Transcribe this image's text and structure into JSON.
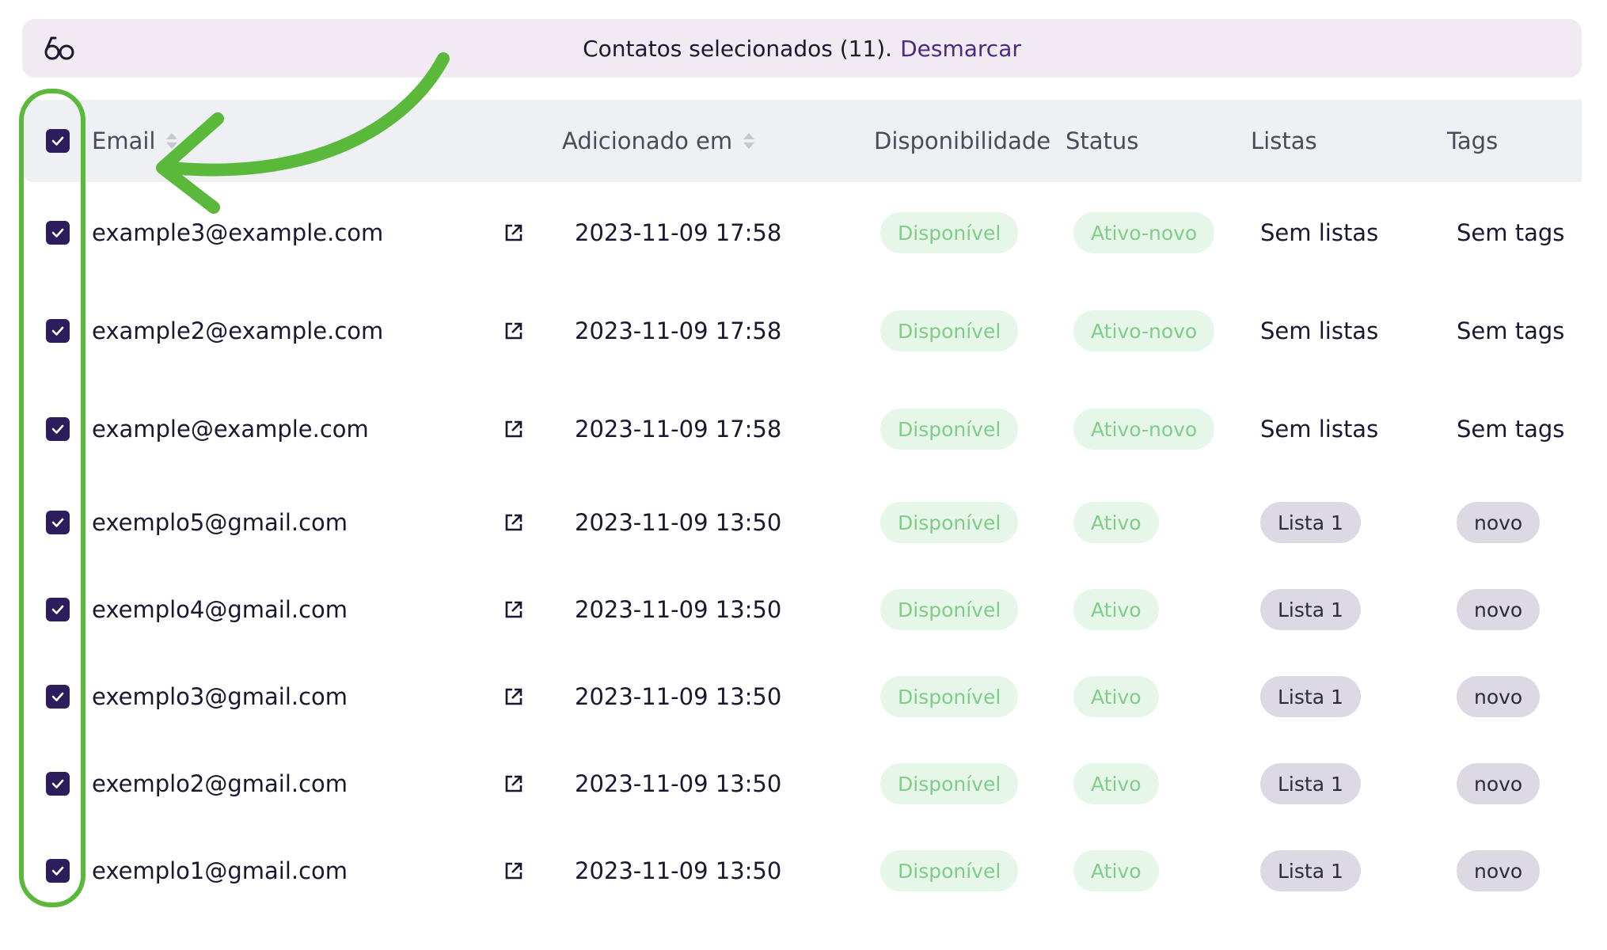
{
  "banner": {
    "message": "Contatos selecionados (11).",
    "unselect_link": "Desmarcar",
    "icon": "glasses-icon"
  },
  "table": {
    "headers": {
      "email": "Email",
      "added": "Adicionado em",
      "availability": "Disponibilidade",
      "status": "Status",
      "lists": "Listas",
      "tags": "Tags"
    },
    "rows": [
      {
        "email": "example3@example.com",
        "added": "2023-11-09 17:58",
        "availability": "Disponível",
        "status": "Ativo-novo",
        "lists": "Sem listas",
        "tags": "Sem tags",
        "checked": true
      },
      {
        "email": "example2@example.com",
        "added": "2023-11-09 17:58",
        "availability": "Disponível",
        "status": "Ativo-novo",
        "lists": "Sem listas",
        "tags": "Sem tags",
        "checked": true
      },
      {
        "email": "example@example.com",
        "added": "2023-11-09 17:58",
        "availability": "Disponível",
        "status": "Ativo-novo",
        "lists": "Sem listas",
        "tags": "Sem tags",
        "checked": true
      },
      {
        "email": "exemplo5@gmail.com",
        "added": "2023-11-09 13:50",
        "availability": "Disponível",
        "status": "Ativo",
        "lists": "Lista 1",
        "tags": "novo",
        "checked": true
      },
      {
        "email": "exemplo4@gmail.com",
        "added": "2023-11-09 13:50",
        "availability": "Disponível",
        "status": "Ativo",
        "lists": "Lista 1",
        "tags": "novo",
        "checked": true
      },
      {
        "email": "exemplo3@gmail.com",
        "added": "2023-11-09 13:50",
        "availability": "Disponível",
        "status": "Ativo",
        "lists": "Lista 1",
        "tags": "novo",
        "checked": true
      },
      {
        "email": "exemplo2@gmail.com",
        "added": "2023-11-09 13:50",
        "availability": "Disponível",
        "status": "Ativo",
        "lists": "Lista 1",
        "tags": "novo",
        "checked": true
      },
      {
        "email": "exemplo1@gmail.com",
        "added": "2023-11-09 13:50",
        "availability": "Disponível",
        "status": "Ativo",
        "lists": "Lista 1",
        "tags": "novo",
        "checked": true
      }
    ]
  },
  "colors": {
    "checkbox": "#2d1d5c",
    "highlight": "#5ab93b",
    "link": "#4b2a80",
    "green_pill_bg": "#e6f6e8",
    "green_pill_text": "#7fcd88",
    "purple_pill_bg": "#ddd9e4"
  }
}
